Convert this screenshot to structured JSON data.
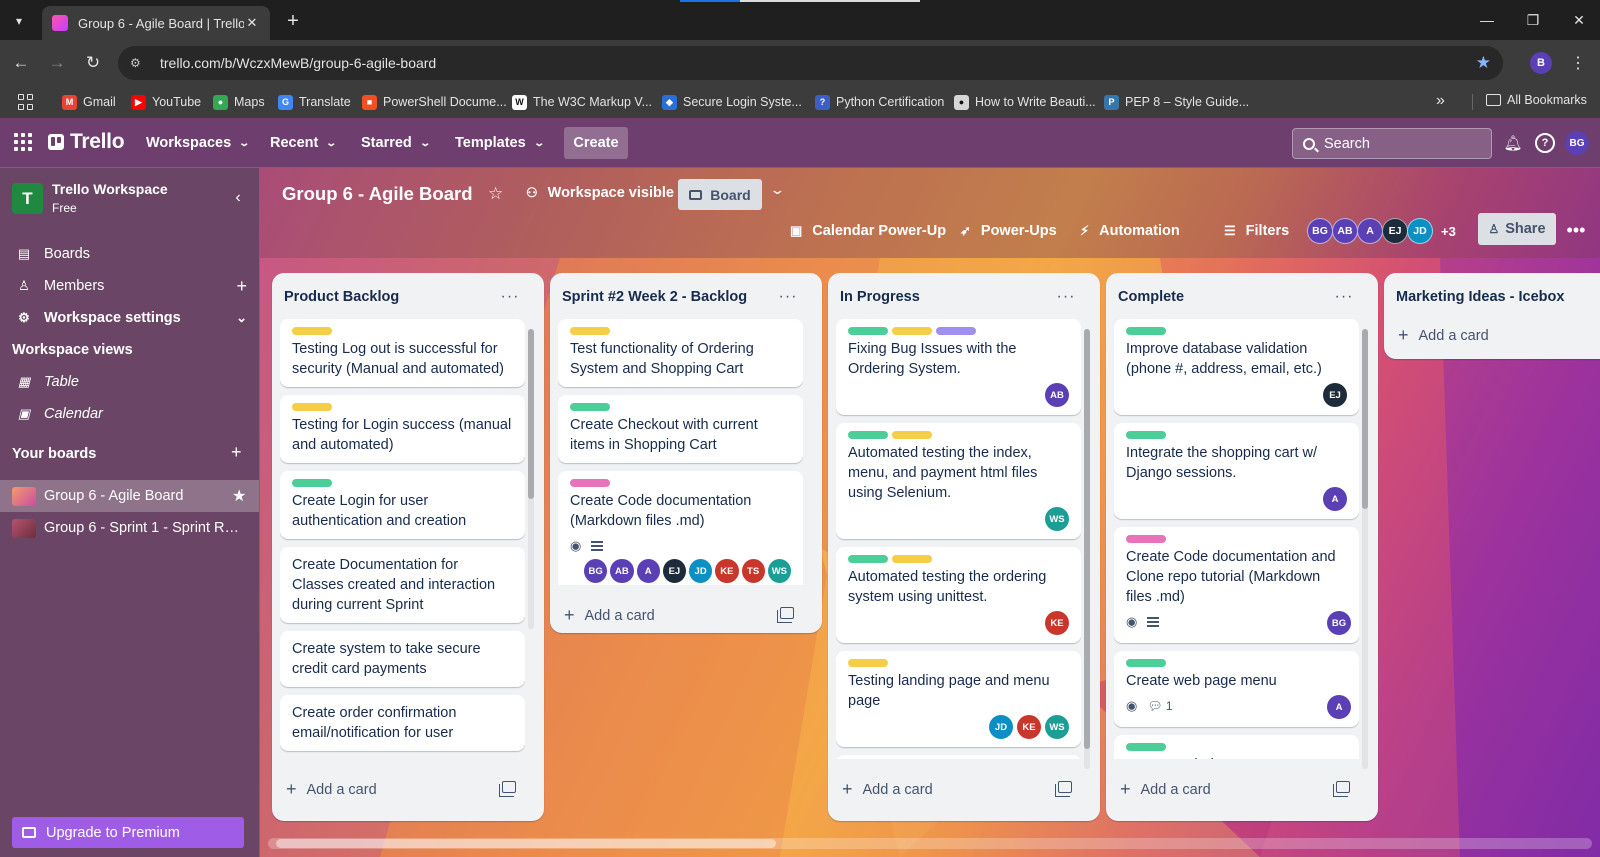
{
  "browser": {
    "tab_title": "Group 6 - Agile Board | Trello",
    "url": "trello.com/b/WczxMewB/group-6-agile-board",
    "profile_initial": "B",
    "bookmarks": [
      {
        "label": "Gmail",
        "color": "#ea4335",
        "glyph": "M"
      },
      {
        "label": "YouTube",
        "color": "#ff0000",
        "glyph": "▶"
      },
      {
        "label": "Maps",
        "color": "#34a853",
        "glyph": "●"
      },
      {
        "label": "Translate",
        "color": "#4285f4",
        "glyph": "G"
      },
      {
        "label": "PowerShell Docume...",
        "color": "#f25022",
        "glyph": "■"
      },
      {
        "label": "The W3C Markup V...",
        "color": "#ffffff",
        "glyph": "W"
      },
      {
        "label": "Secure Login Syste...",
        "color": "#2b6ed9",
        "glyph": "◆"
      },
      {
        "label": "Python Certification",
        "color": "#3b5fc4",
        "glyph": "?"
      },
      {
        "label": "How to Write Beauti...",
        "color": "#d6d6d6",
        "glyph": "●"
      },
      {
        "label": "PEP 8 – Style Guide...",
        "color": "#3776ab",
        "glyph": "P"
      }
    ],
    "all_bookmarks": "All Bookmarks"
  },
  "header": {
    "logo": "Trello",
    "nav": [
      "Workspaces",
      "Recent",
      "Starred",
      "Templates"
    ],
    "create": "Create",
    "search_placeholder": "Search",
    "user_initials": "BG"
  },
  "sidebar": {
    "workspace_initial": "T",
    "workspace_name": "Trello Workspace",
    "workspace_plan": "Free",
    "items": [
      {
        "label": "Boards",
        "icon": "board-icon"
      },
      {
        "label": "Members",
        "icon": "person-icon"
      },
      {
        "label": "Workspace settings",
        "icon": "gear-icon"
      }
    ],
    "views_title": "Workspace views",
    "views": [
      {
        "label": "Table",
        "icon": "table-icon"
      },
      {
        "label": "Calendar",
        "icon": "calendar-icon"
      }
    ],
    "boards_title": "Your boards",
    "boards": [
      {
        "label": "Group 6 - Agile Board",
        "active": true
      },
      {
        "label": "Group 6 - Sprint 1 - Sprint Retr...",
        "active": false
      }
    ],
    "upgrade": "Upgrade to Premium"
  },
  "board": {
    "title": "Group 6 - Agile Board",
    "visibility": "Workspace visible",
    "view": "Board",
    "tools": [
      "Calendar Power-Up",
      "Power-Ups",
      "Automation",
      "Filters"
    ],
    "members": [
      {
        "initials": "BG",
        "color": "#5b3fb5"
      },
      {
        "initials": "AB",
        "color": "#5b3fb5"
      },
      {
        "initials": "A",
        "color": "#5b3fb5"
      },
      {
        "initials": "EJ",
        "color": "#1d2b3a"
      },
      {
        "initials": "JD",
        "color": "#0c8fc2"
      }
    ],
    "members_more": "+3",
    "share": "Share"
  },
  "colors": {
    "yellow": "#f5cd47",
    "green": "#4bce97",
    "purple": "#9f8fef",
    "pink": "#e774bb",
    "BG": "#5b3fb5",
    "AB": "#5b3fb5",
    "A": "#5b3fb5",
    "EJ": "#1d2b3a",
    "JD": "#0c8fc2",
    "KE": "#c9372c",
    "TS": "#c9372c",
    "WS": "#1a9e96"
  },
  "lists": [
    {
      "title": "Product Backlog",
      "add": "Add a card",
      "cards": [
        {
          "labels": [
            "yellow"
          ],
          "text": "Testing Log out is successful for security (Manual and automated)"
        },
        {
          "labels": [
            "yellow"
          ],
          "text": "Testing for Login success (manual and automated)"
        },
        {
          "labels": [
            "green"
          ],
          "text": "Create Login for user authentication and creation"
        },
        {
          "labels": [],
          "text": "Create Documentation for Classes created and interaction during current Sprint"
        },
        {
          "labels": [],
          "text": "Create system to take secure credit card payments"
        },
        {
          "labels": [],
          "text": "Create order confirmation email/notification for user"
        }
      ]
    },
    {
      "title": "Sprint #2 Week 2 - Backlog",
      "add": "Add a card",
      "cards": [
        {
          "labels": [
            "yellow"
          ],
          "text": "Test functionality of Ordering System and Shopping Cart"
        },
        {
          "labels": [
            "green"
          ],
          "text": "Create Checkout with current items in Shopping Cart"
        },
        {
          "labels": [
            "pink"
          ],
          "text": "Create Code documentation (Markdown files .md)",
          "badges": true,
          "members": [
            "BG",
            "AB",
            "A",
            "EJ",
            "JD",
            "KE",
            "TS",
            "WS"
          ]
        }
      ]
    },
    {
      "title": "In Progress",
      "add": "Add a card",
      "cards": [
        {
          "labels": [
            "green",
            "yellow",
            "purple"
          ],
          "text": "Fixing Bug Issues with the Ordering System.",
          "members": [
            "AB"
          ]
        },
        {
          "labels": [
            "green",
            "yellow"
          ],
          "text": "Automated testing the index, menu, and payment html files using Selenium.",
          "members": [
            "WS"
          ]
        },
        {
          "labels": [
            "green",
            "yellow"
          ],
          "text": "Automated testing the ordering system using unittest.",
          "members": [
            "KE"
          ]
        },
        {
          "labels": [
            "yellow"
          ],
          "text": "Testing landing page and menu page",
          "members": [
            "JD",
            "KE",
            "WS"
          ]
        },
        {
          "labels": [
            "yellow"
          ],
          "text": ""
        }
      ]
    },
    {
      "title": "Complete",
      "add": "Add a card",
      "cards": [
        {
          "labels": [
            "green"
          ],
          "text": "Improve database validation (phone #, address, email, etc.)",
          "members": [
            "EJ"
          ]
        },
        {
          "labels": [
            "green"
          ],
          "text": "Integrate the shopping cart w/ Django sessions.",
          "members": [
            "A"
          ]
        },
        {
          "labels": [
            "pink"
          ],
          "text": "Create Code documentation and Clone repo tutorial (Markdown files .md)",
          "badges": true,
          "members": [
            "BG"
          ]
        },
        {
          "labels": [
            "green"
          ],
          "text": "Create web page menu",
          "badges": true,
          "comments": "1",
          "members": [
            "A"
          ]
        },
        {
          "labels": [
            "green"
          ],
          "text": "Create Ordering system"
        }
      ]
    },
    {
      "title": "Marketing Ideas - Icebox",
      "add": "Add a card",
      "cards": []
    }
  ]
}
